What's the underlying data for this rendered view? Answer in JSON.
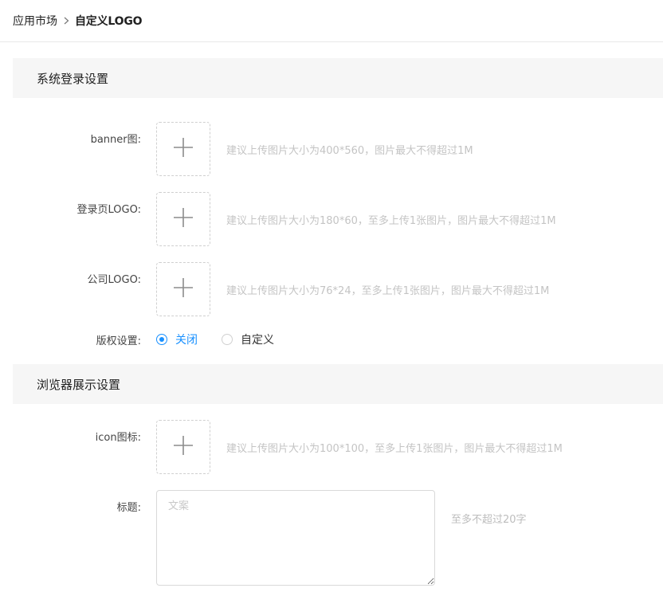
{
  "breadcrumb": {
    "root": "应用市场",
    "current": "自定义LOGO"
  },
  "sections": {
    "login": {
      "title": "系统登录设置"
    },
    "browser": {
      "title": "浏览器展示设置"
    }
  },
  "fields": {
    "banner": {
      "label": "banner图:",
      "hint": "建议上传图片大小为400*560，图片最大不得超过1M"
    },
    "login_logo": {
      "label": "登录页LOGO:",
      "hint": "建议上传图片大小为180*60，至多上传1张图片，图片最大不得超过1M"
    },
    "company_logo": {
      "label": "公司LOGO:",
      "hint": "建议上传图片大小为76*24，至多上传1张图片，图片最大不得超过1M"
    },
    "copyright": {
      "label": "版权设置:",
      "options": [
        "关闭",
        "自定义"
      ],
      "selected": "关闭"
    },
    "icon": {
      "label": "icon图标:",
      "hint": "建议上传图片大小为100*100，至多上传1张图片，图片最大不得超过1M"
    },
    "title": {
      "label": "标题:",
      "placeholder": "文案",
      "hint": "至多不超过20字"
    }
  },
  "colors": {
    "accent": "#1890ff",
    "section_bg": "#f6f6f6",
    "hint_text": "#c4c4c4"
  },
  "icons": {
    "upload": "plus-icon",
    "breadcrumb_separator": "chevron-right-icon"
  }
}
